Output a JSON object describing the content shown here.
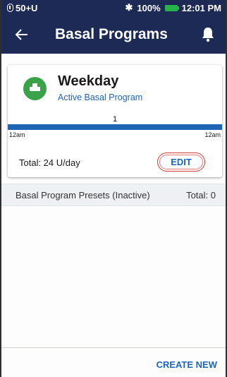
{
  "status_bar": {
    "pod_status": "50+U",
    "battery_percent": "100%",
    "time": "12:01 PM",
    "icons": [
      "pod-icon",
      "bluetooth-icon",
      "battery-icon"
    ]
  },
  "header": {
    "title": "Basal Programs",
    "back_icon": "arrow-left-icon",
    "bell_icon": "bell-icon",
    "background_color": "#1d2a55"
  },
  "active_program": {
    "name": "Weekday",
    "status": "Active Basal Program",
    "rate": "1",
    "start_time": "12am",
    "end_time": "12am",
    "total": "Total: 24 U/day",
    "edit_label": "EDIT",
    "icon": "basal-program-icon",
    "icon_color": "#3aa34a",
    "bar_color": "#1f65b5"
  },
  "presets": {
    "title": "Basal Program Presets (Inactive)",
    "total": "Total: 0"
  },
  "footer": {
    "create_new_label": "CREATE NEW"
  }
}
